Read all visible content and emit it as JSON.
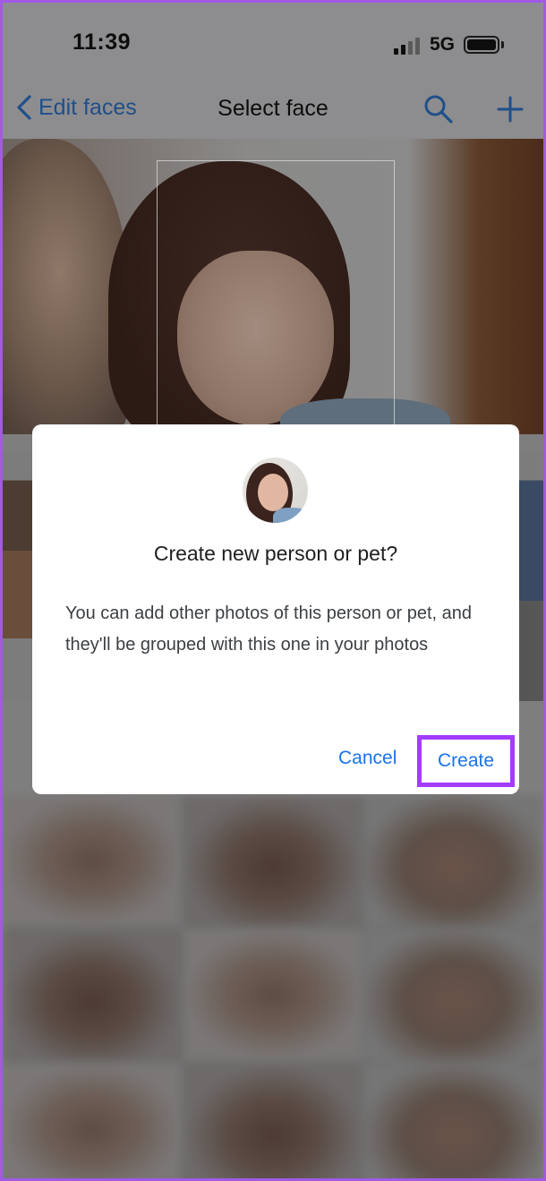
{
  "status_bar": {
    "time": "11:39",
    "network": "5G"
  },
  "nav": {
    "back_label": "Edit faces",
    "title": "Select face"
  },
  "dialog": {
    "title": "Create new person or pet?",
    "body": "You can add other photos of this person or pet, and they'll be grouped with this one in your photos",
    "cancel_label": "Cancel",
    "create_label": "Create"
  },
  "icons": {
    "back": "chevron-left-icon",
    "search": "search-icon",
    "add": "plus-icon",
    "signal": "cellular-signal-icon",
    "battery": "battery-icon"
  },
  "colors": {
    "accent": "#1a73e8",
    "highlight": "#a43bff",
    "nav_text": "#1f4f8a"
  }
}
